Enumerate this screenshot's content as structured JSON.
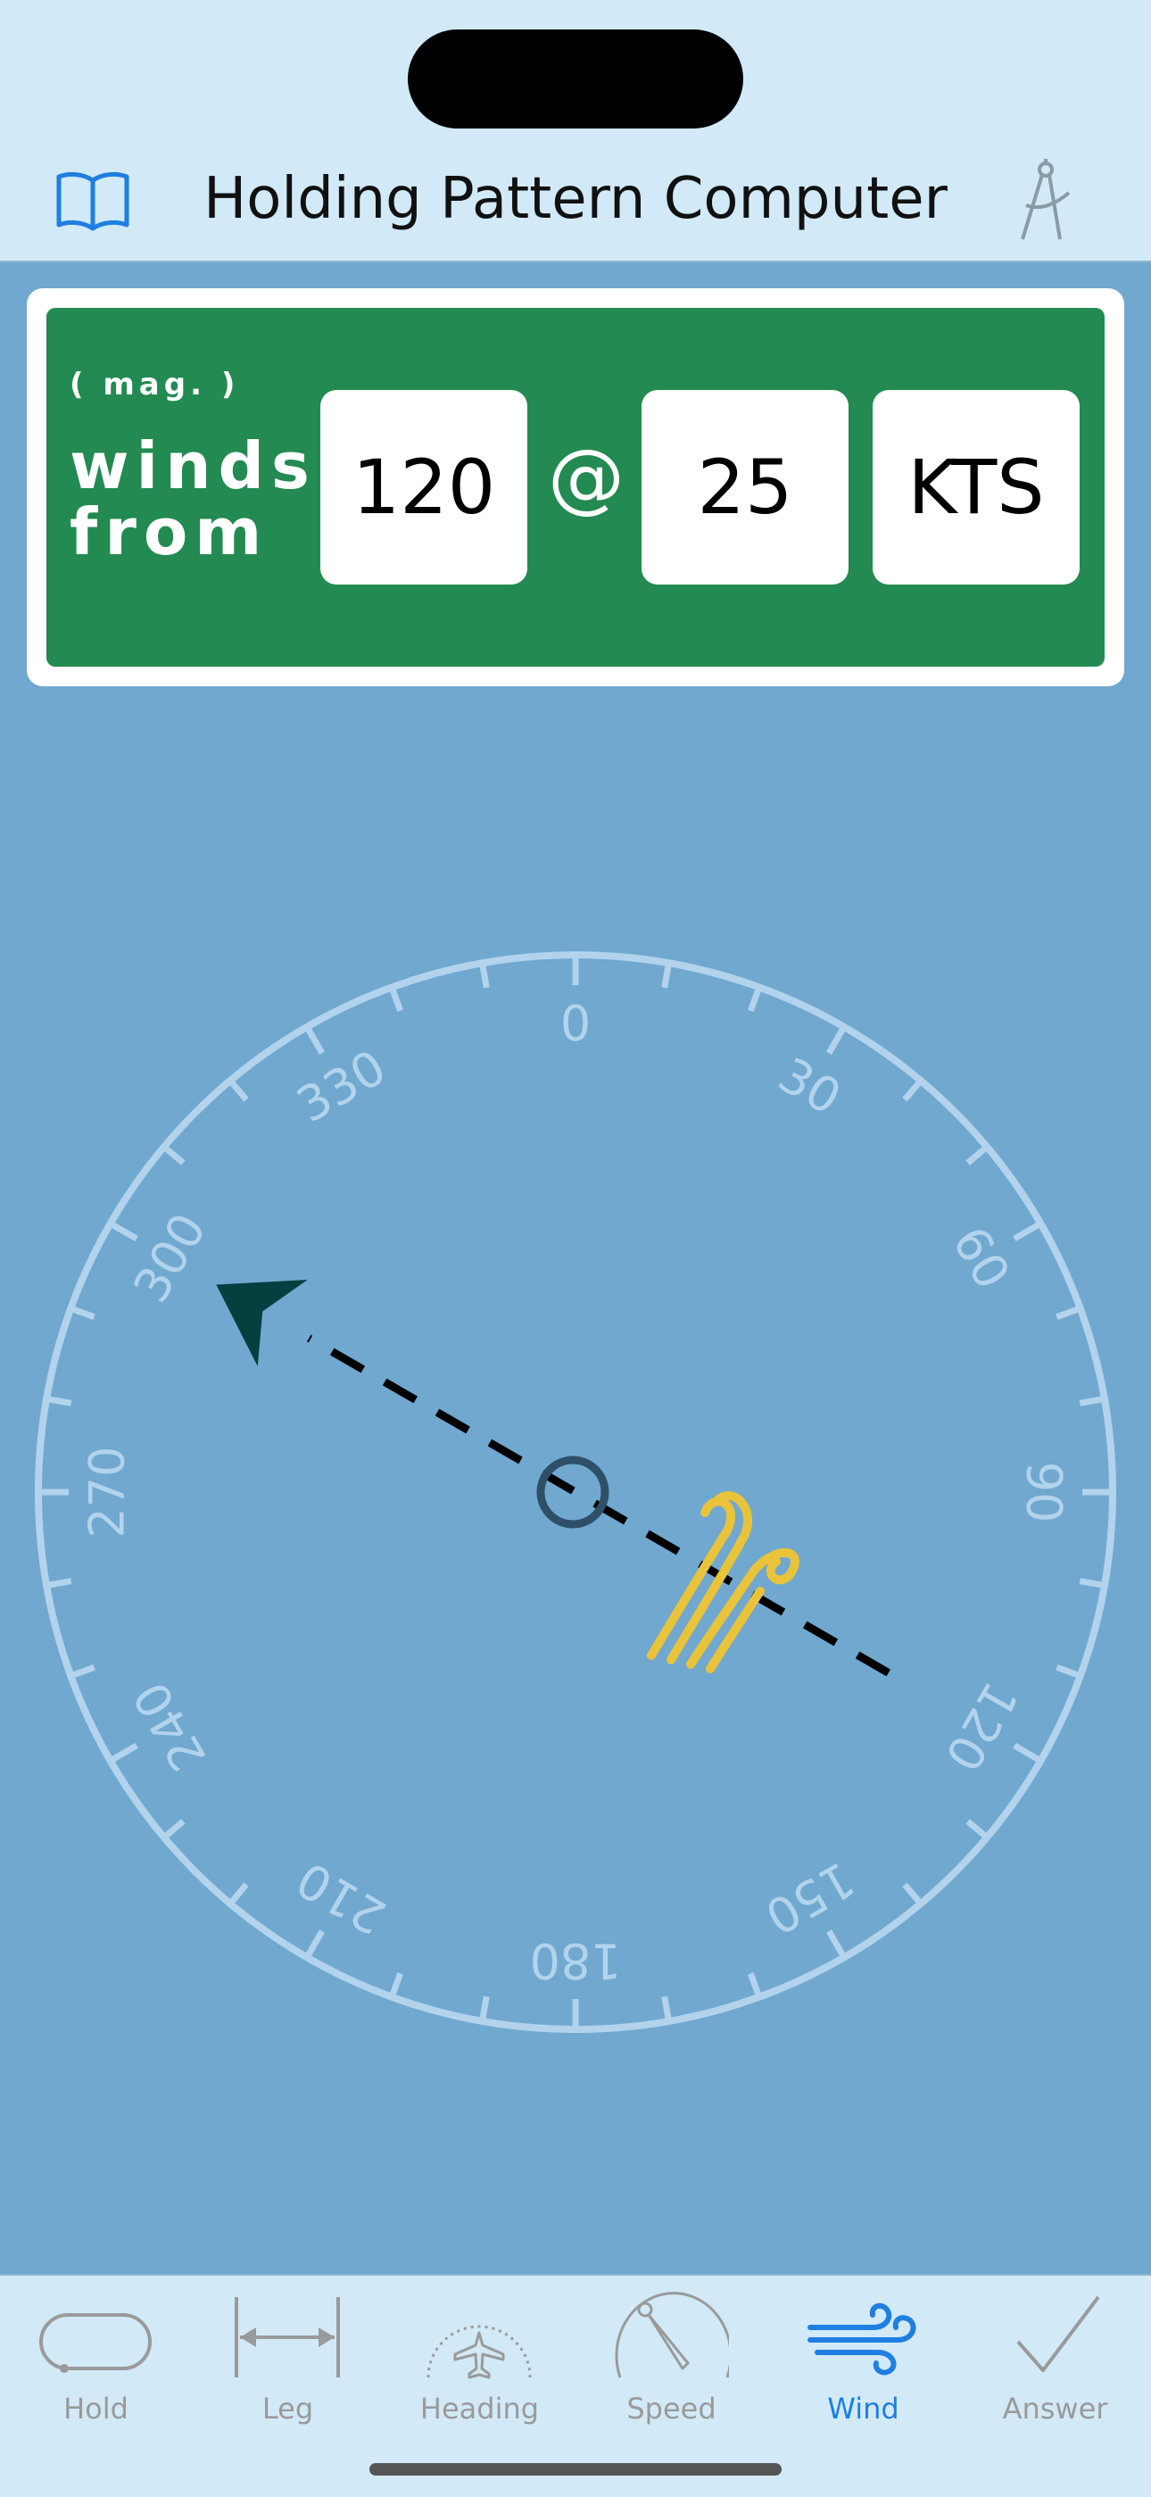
{
  "nav": {
    "title": "Holding Pattern Computer",
    "left_icon": "book-open-icon",
    "right_icon": "drafting-compass-icon"
  },
  "wind": {
    "mag_label": "( mag. )",
    "label_line1": "winds",
    "label_line2": "from",
    "direction": "120",
    "at": "@",
    "speed": "25",
    "unit": "KTS",
    "panel_color": "#238a52"
  },
  "compass": {
    "labels": [
      "0",
      "30",
      "60",
      "90",
      "120",
      "150",
      "180",
      "210",
      "240",
      "270",
      "300",
      "330"
    ],
    "wind_from_deg": 120,
    "arrow_color": "#063f3f",
    "wind_icon_color": "#e9c33a",
    "ring_color": "#b3d3ec"
  },
  "tabs": [
    {
      "label": "Hold",
      "icon": "hold-racetrack-icon",
      "active": false
    },
    {
      "label": "Leg",
      "icon": "leg-length-icon",
      "active": false
    },
    {
      "label": "Heading",
      "icon": "heading-indicator-icon",
      "active": false
    },
    {
      "label": "Speed",
      "icon": "speed-gauge-icon",
      "active": false
    },
    {
      "label": "Wind",
      "icon": "wind-icon",
      "active": true
    },
    {
      "label": "Answer",
      "icon": "checkmark-icon",
      "active": false
    }
  ],
  "colors": {
    "accent": "#1e7fe0",
    "background": "#70a8d0",
    "bar": "#d2e9f7"
  }
}
